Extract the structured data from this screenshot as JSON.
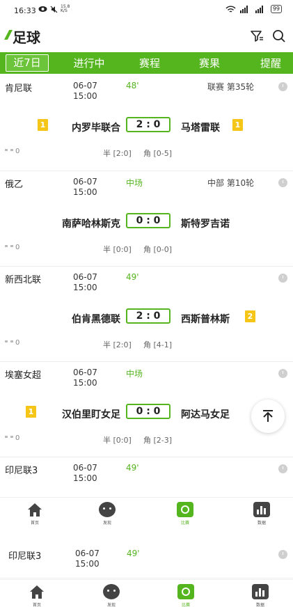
{
  "status_bar": {
    "time": "16:33",
    "speed_value": "15.8",
    "speed_unit": "K/S",
    "battery": "99"
  },
  "header": {
    "title": "足球"
  },
  "tabs": [
    "近7日",
    "进行中",
    "赛程",
    "赛果",
    "提醒"
  ],
  "matches": [
    {
      "league": "肯尼联",
      "date": "06-07",
      "time": "15:00",
      "status": "48'",
      "round": "联赛 第35轮",
      "home": "内罗毕联合",
      "away": "马塔雷联",
      "score": "2 : 0",
      "home_card": "1",
      "away_card": "1",
      "people": "0",
      "half": "半 [2:0]",
      "corner": "角 [0-5]"
    },
    {
      "league": "俄乙",
      "date": "06-07",
      "time": "15:00",
      "status": "中场",
      "round": "中部 第10轮",
      "home": "南萨哈林斯克",
      "away": "斯特罗吉诺",
      "score": "0 : 0",
      "home_card": "",
      "away_card": "",
      "people": "0",
      "half": "半 [0:0]",
      "corner": "角 [0-0]"
    },
    {
      "league": "新西北联",
      "date": "06-07",
      "time": "15:00",
      "status": "49'",
      "round": "",
      "home": "伯肯黑德联",
      "away": "西斯普林斯",
      "score": "2 : 0",
      "home_card": "",
      "away_card": "2",
      "people": "0",
      "half": "半 [2:0]",
      "corner": "角 [4-1]"
    },
    {
      "league": "埃塞女超",
      "date": "06-07",
      "time": "15:00",
      "status": "中场",
      "round": "",
      "home": "汉伯里盯女足",
      "away": "阿达马女足",
      "score": "0 : 0",
      "home_card": "1",
      "away_card": "",
      "people": "0",
      "half": "半 [0:0]",
      "corner": "角 [2-3]"
    },
    {
      "league": "印尼联3",
      "date": "06-07",
      "time": "15:00",
      "status": "49'",
      "round": ""
    }
  ],
  "lower_match": {
    "league": "印尼联3",
    "date": "06-07",
    "time": "15:00",
    "status": "49'"
  },
  "bottom_nav": [
    {
      "label": "首页",
      "icon": "home-icon"
    },
    {
      "label": "发现",
      "icon": "discover-icon"
    },
    {
      "label": "比赛",
      "icon": "match-icon"
    },
    {
      "label": "数据",
      "icon": "data-icon"
    }
  ],
  "colors": {
    "brand": "#55b51e",
    "card_yellow": "#f5c518"
  }
}
